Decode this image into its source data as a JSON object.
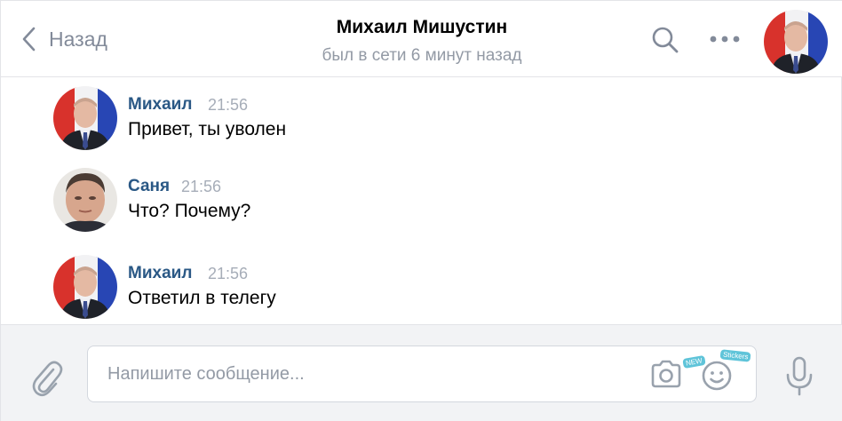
{
  "header": {
    "back_label": "Назад",
    "title": "Михаил Мишустин",
    "status": "был в сети 6 минут назад",
    "icons": [
      "chevron-left-icon",
      "search-icon",
      "more-icon"
    ],
    "accent": "#2a5885"
  },
  "messages": [
    {
      "name": "Михаил",
      "time": "21:56",
      "text": "Привет, ты уволен"
    },
    {
      "name": "Саня",
      "time": "21:56",
      "text": "Что? Почему?"
    },
    {
      "name": "Михаил",
      "time": "21:56",
      "text": "Ответил в телегу"
    }
  ],
  "composer": {
    "placeholder": "Напишите сообщение...",
    "value": "",
    "sticker_tags": [
      "NEW",
      "Stickers"
    ],
    "icons": [
      "paperclip-icon",
      "camera-icon",
      "smile-icon",
      "microphone-icon"
    ]
  }
}
